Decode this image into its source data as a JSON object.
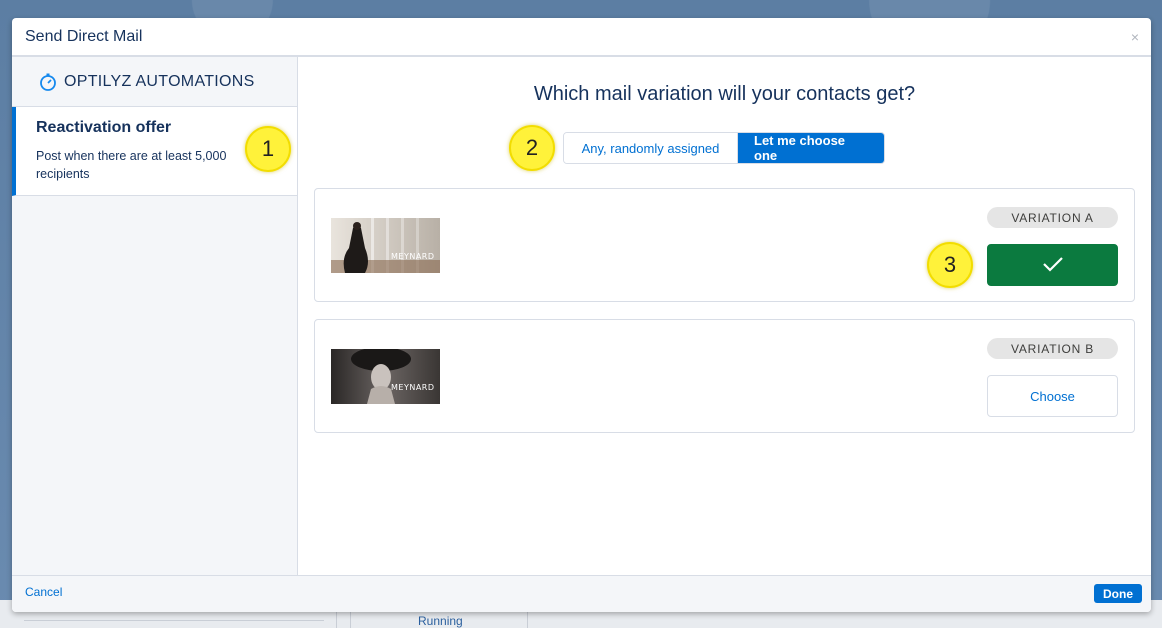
{
  "modal": {
    "title": "Send Direct Mail",
    "close_label": "×"
  },
  "sidebar": {
    "brand": "OPTILYZ AUTOMATIONS",
    "items": [
      {
        "title": "Reactivation offer",
        "description": "Post when there are at least 5,000 recipients"
      }
    ]
  },
  "main": {
    "question": "Which mail variation will your contacts get?",
    "toggle": {
      "options": [
        "Any, randomly assigned",
        "Let me choose one"
      ],
      "selected": "Let me choose one"
    },
    "variations": [
      {
        "label": "VARIATION A",
        "brand": "MEYNARD",
        "state": "chosen",
        "button_label": ""
      },
      {
        "label": "VARIATION B",
        "brand": "MEYNARD",
        "state": "unchosen",
        "button_label": "Choose"
      }
    ]
  },
  "badges": [
    "1",
    "2",
    "3"
  ],
  "footer": {
    "cancel_label": "Cancel",
    "done_label": "Done"
  },
  "background": {
    "status_text": "Running"
  },
  "colors": {
    "accent": "#0070d2",
    "success": "#0b7a3f",
    "badge": "#fff23a",
    "text": "#16325c"
  }
}
